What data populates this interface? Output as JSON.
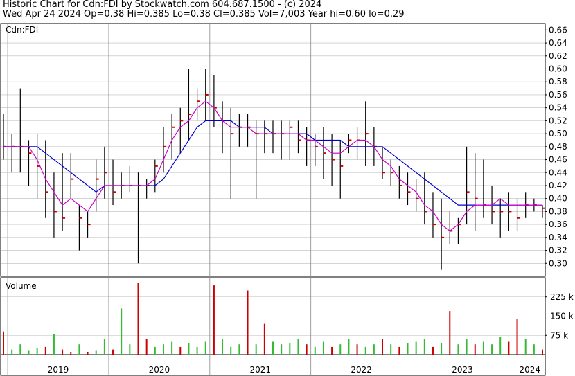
{
  "header": {
    "line1": "Historic Chart for Cdn:FDI by Stockwatch.com 604.687.1500 - (c) 2024",
    "line2": "Wed Apr 24 2024   Op=0.38   Hi=0.385   Lo=0.38   Cl=0.385   Vol=7,003   Year hi=0.60   lo=0.29"
  },
  "colors": {
    "bar": "#000000",
    "close_tick": "#cc0000",
    "ma_short": "#cc00cc",
    "ma_long": "#0000cc",
    "volume_up": "#33bb33",
    "volume_down": "#cc0000",
    "grid": "#bbbbbb"
  },
  "chart_data": [
    {
      "type": "ohlc",
      "title": "Cdn:FDI",
      "ylim": [
        0.28,
        0.67
      ],
      "yticks": [
        "0.66",
        "0.64",
        "0.62",
        "0.60",
        "0.58",
        "0.56",
        "0.54",
        "0.52",
        "0.50",
        "0.48",
        "0.46",
        "0.44",
        "0.42",
        "0.40",
        "0.38",
        "0.36",
        "0.34",
        "0.32",
        "0.30"
      ],
      "x_labels": [
        "2019",
        "2020",
        "2021",
        "2022",
        "2023",
        "2024"
      ],
      "x": [
        "2018-12",
        "2019-01",
        "2019-02",
        "2019-03",
        "2019-04",
        "2019-05",
        "2019-06",
        "2019-07",
        "2019-08",
        "2019-09",
        "2019-10",
        "2019-11",
        "2019-12",
        "2020-01",
        "2020-02",
        "2020-03",
        "2020-04",
        "2020-05",
        "2020-06",
        "2020-07",
        "2020-08",
        "2020-09",
        "2020-10",
        "2020-11",
        "2020-12",
        "2021-01",
        "2021-02",
        "2021-03",
        "2021-04",
        "2021-05",
        "2021-06",
        "2021-07",
        "2021-08",
        "2021-09",
        "2021-10",
        "2021-11",
        "2021-12",
        "2022-01",
        "2022-02",
        "2022-03",
        "2022-04",
        "2022-05",
        "2022-06",
        "2022-07",
        "2022-08",
        "2022-09",
        "2022-10",
        "2022-11",
        "2022-12",
        "2023-01",
        "2023-02",
        "2023-03",
        "2023-04",
        "2023-05",
        "2023-06",
        "2023-07",
        "2023-08",
        "2023-09",
        "2023-10",
        "2023-11",
        "2023-12",
        "2024-01",
        "2024-02",
        "2024-03",
        "2024-04"
      ],
      "high": [
        0.53,
        0.5,
        0.57,
        0.49,
        0.5,
        0.49,
        0.44,
        0.47,
        0.47,
        0.39,
        0.38,
        0.46,
        0.48,
        0.46,
        0.44,
        0.45,
        0.44,
        0.43,
        0.46,
        0.51,
        0.53,
        0.54,
        0.6,
        0.57,
        0.6,
        0.59,
        0.55,
        0.54,
        0.53,
        0.53,
        0.52,
        0.52,
        0.52,
        0.52,
        0.52,
        0.52,
        0.51,
        0.5,
        0.51,
        0.5,
        0.49,
        0.5,
        0.51,
        0.55,
        0.51,
        0.48,
        0.46,
        0.45,
        0.44,
        0.43,
        0.44,
        0.41,
        0.4,
        0.38,
        0.37,
        0.48,
        0.47,
        0.46,
        0.42,
        0.4,
        0.41,
        0.4,
        0.41,
        0.4,
        0.39
      ],
      "low": [
        0.46,
        0.44,
        0.44,
        0.42,
        0.4,
        0.37,
        0.34,
        0.35,
        0.4,
        0.32,
        0.34,
        0.38,
        0.4,
        0.39,
        0.4,
        0.41,
        0.3,
        0.4,
        0.41,
        0.44,
        0.46,
        0.47,
        0.49,
        0.52,
        0.52,
        0.51,
        0.47,
        0.4,
        0.48,
        0.48,
        0.4,
        0.47,
        0.47,
        0.46,
        0.46,
        0.47,
        0.45,
        0.45,
        0.43,
        0.42,
        0.4,
        0.47,
        0.46,
        0.45,
        0.45,
        0.43,
        0.42,
        0.4,
        0.39,
        0.38,
        0.36,
        0.34,
        0.29,
        0.33,
        0.33,
        0.36,
        0.35,
        0.37,
        0.36,
        0.34,
        0.35,
        0.35,
        0.37,
        0.38,
        0.37
      ],
      "close": [
        0.48,
        0.48,
        0.48,
        0.47,
        0.45,
        0.41,
        0.38,
        0.37,
        0.43,
        0.37,
        0.36,
        0.43,
        0.44,
        0.41,
        0.42,
        0.42,
        0.42,
        0.42,
        0.45,
        0.48,
        0.51,
        0.52,
        0.53,
        0.55,
        0.56,
        0.54,
        0.52,
        0.5,
        0.51,
        0.51,
        0.5,
        0.5,
        0.5,
        0.5,
        0.51,
        0.49,
        0.49,
        0.48,
        0.47,
        0.46,
        0.45,
        0.49,
        0.49,
        0.5,
        0.48,
        0.44,
        0.44,
        0.42,
        0.41,
        0.4,
        0.38,
        0.36,
        0.34,
        0.35,
        0.36,
        0.41,
        0.4,
        0.39,
        0.38,
        0.38,
        0.38,
        0.37,
        0.39,
        0.39,
        0.385
      ],
      "ma_short": [
        0.48,
        0.48,
        0.48,
        0.48,
        0.46,
        0.43,
        0.41,
        0.39,
        0.4,
        0.39,
        0.38,
        0.4,
        0.42,
        0.42,
        0.42,
        0.42,
        0.42,
        0.42,
        0.43,
        0.46,
        0.49,
        0.51,
        0.52,
        0.54,
        0.55,
        0.54,
        0.52,
        0.51,
        0.51,
        0.51,
        0.5,
        0.5,
        0.5,
        0.5,
        0.5,
        0.5,
        0.49,
        0.49,
        0.48,
        0.47,
        0.47,
        0.48,
        0.49,
        0.49,
        0.48,
        0.46,
        0.45,
        0.43,
        0.42,
        0.41,
        0.39,
        0.38,
        0.36,
        0.35,
        0.36,
        0.38,
        0.39,
        0.39,
        0.39,
        0.4,
        0.39,
        0.39,
        0.39,
        0.39,
        0.39
      ],
      "ma_long": [
        0.48,
        0.48,
        0.48,
        0.48,
        0.48,
        0.47,
        0.46,
        0.45,
        0.44,
        0.43,
        0.42,
        0.41,
        0.42,
        0.42,
        0.42,
        0.42,
        0.42,
        0.42,
        0.42,
        0.43,
        0.45,
        0.47,
        0.49,
        0.51,
        0.52,
        0.52,
        0.52,
        0.52,
        0.51,
        0.51,
        0.51,
        0.51,
        0.5,
        0.5,
        0.5,
        0.5,
        0.5,
        0.49,
        0.49,
        0.49,
        0.49,
        0.48,
        0.48,
        0.48,
        0.48,
        0.48,
        0.47,
        0.46,
        0.45,
        0.44,
        0.43,
        0.42,
        0.41,
        0.4,
        0.39,
        0.39,
        0.39,
        0.39,
        0.39,
        0.39,
        0.39,
        0.39,
        0.39,
        0.39,
        0.39
      ]
    },
    {
      "type": "bar",
      "title": "Volume",
      "ylim": [
        0,
        300
      ],
      "yticks": [
        "225 k",
        "150 k",
        "75 k"
      ],
      "unit": "k",
      "values": [
        90,
        20,
        40,
        15,
        25,
        30,
        80,
        20,
        10,
        40,
        10,
        15,
        60,
        20,
        180,
        40,
        280,
        60,
        30,
        40,
        50,
        30,
        45,
        30,
        50,
        270,
        60,
        30,
        40,
        250,
        40,
        120,
        50,
        40,
        45,
        60,
        40,
        30,
        50,
        30,
        40,
        60,
        40,
        30,
        40,
        60,
        40,
        30,
        45,
        50,
        60,
        30,
        45,
        170,
        40,
        60,
        40,
        50,
        40,
        70,
        50,
        140,
        60,
        40,
        20
      ],
      "up": [
        0,
        1,
        1,
        1,
        1,
        0,
        1,
        0,
        0,
        1,
        0,
        1,
        1,
        0,
        1,
        1,
        0,
        0,
        1,
        1,
        1,
        0,
        1,
        1,
        1,
        0,
        1,
        1,
        1,
        0,
        1,
        0,
        1,
        1,
        1,
        1,
        0,
        1,
        1,
        0,
        1,
        1,
        0,
        1,
        1,
        0,
        1,
        0,
        1,
        1,
        1,
        0,
        1,
        0,
        1,
        1,
        0,
        1,
        1,
        1,
        0,
        0,
        1,
        1,
        0
      ]
    }
  ]
}
